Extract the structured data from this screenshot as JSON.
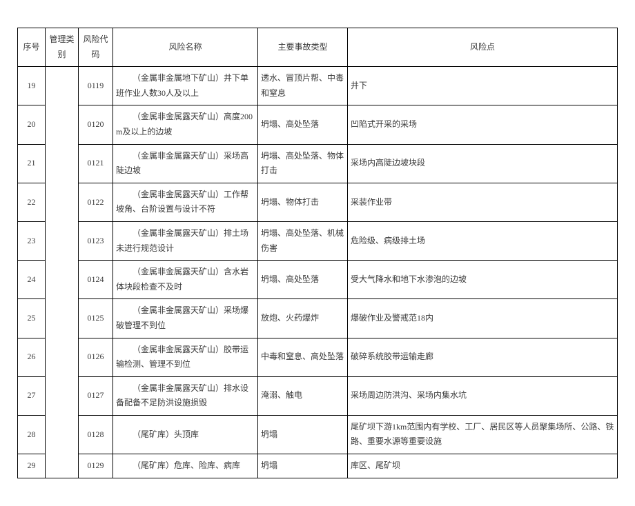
{
  "headers": {
    "seq": "序号",
    "category": "管理类别",
    "code": "风险代码",
    "name": "风险名称",
    "accident_type": "主要事故类型",
    "point": "风险点"
  },
  "rows": [
    {
      "seq": "19",
      "code": "0119",
      "name": "（金属非金属地下矿山）井下单班作业人数30人及以上",
      "accident_type": "透水、冒顶片帮、中毒和窒息",
      "point": "井下"
    },
    {
      "seq": "20",
      "code": "0120",
      "name": "（金属非金属露天矿山）高度200m及以上的边坡",
      "accident_type": "坍塌、高处坠落",
      "point": "凹陷式开采的采场"
    },
    {
      "seq": "21",
      "code": "0121",
      "name": "（金属非金属露天矿山）采场高陡边坡",
      "accident_type": "坍塌、高处坠落、物体打击",
      "point": "采场内高陡边坡块段"
    },
    {
      "seq": "22",
      "code": "0122",
      "name": "（金属非金属露天矿山）工作帮坡角、台阶设置与设计不符",
      "accident_type": "坍塌、物体打击",
      "point": "采装作业带"
    },
    {
      "seq": "23",
      "code": "0123",
      "name": "（金属非金属露天矿山）排土场未进行规范设计",
      "accident_type": "坍塌、高处坠落、机械伤害",
      "point": "危险级、病级排土场"
    },
    {
      "seq": "24",
      "code": "0124",
      "name": "（金属非金属露天矿山）含水岩体块段检查不及时",
      "accident_type": "坍塌、高处坠落",
      "point": "受大气降水和地下水渗泡的边坡"
    },
    {
      "seq": "25",
      "code": "0125",
      "name": "（金属非金属露天矿山）采场爆破管理不到位",
      "accident_type": "放炮、火药爆炸",
      "point": "爆破作业及警戒范18内"
    },
    {
      "seq": "26",
      "code": "0126",
      "name": "（金属非金属露天矿山）胶带运输检测、管理不到位",
      "accident_type": "中毒和窒息、高处坠落",
      "point": "破碎系统胶带运输走廊"
    },
    {
      "seq": "27",
      "code": "0127",
      "name": "（金属非金属露天矿山）排水设备配备不足防洪设施损毁",
      "accident_type": "淹溺、触电",
      "point": "采场周边防洪沟、采场内集水坑"
    },
    {
      "seq": "28",
      "code": "0128",
      "name": "（尾矿库）头顶库",
      "accident_type": "坍塌",
      "point": "尾矿坝下游1km范围内有学校、工厂、居民区等人员聚集场所、公路、铁路、重要水源等重要设施"
    },
    {
      "seq": "29",
      "code": "0129",
      "name": "（尾矿库）危库、险库、病库",
      "accident_type": "坍塌",
      "point": "库区、尾矿坝"
    }
  ]
}
